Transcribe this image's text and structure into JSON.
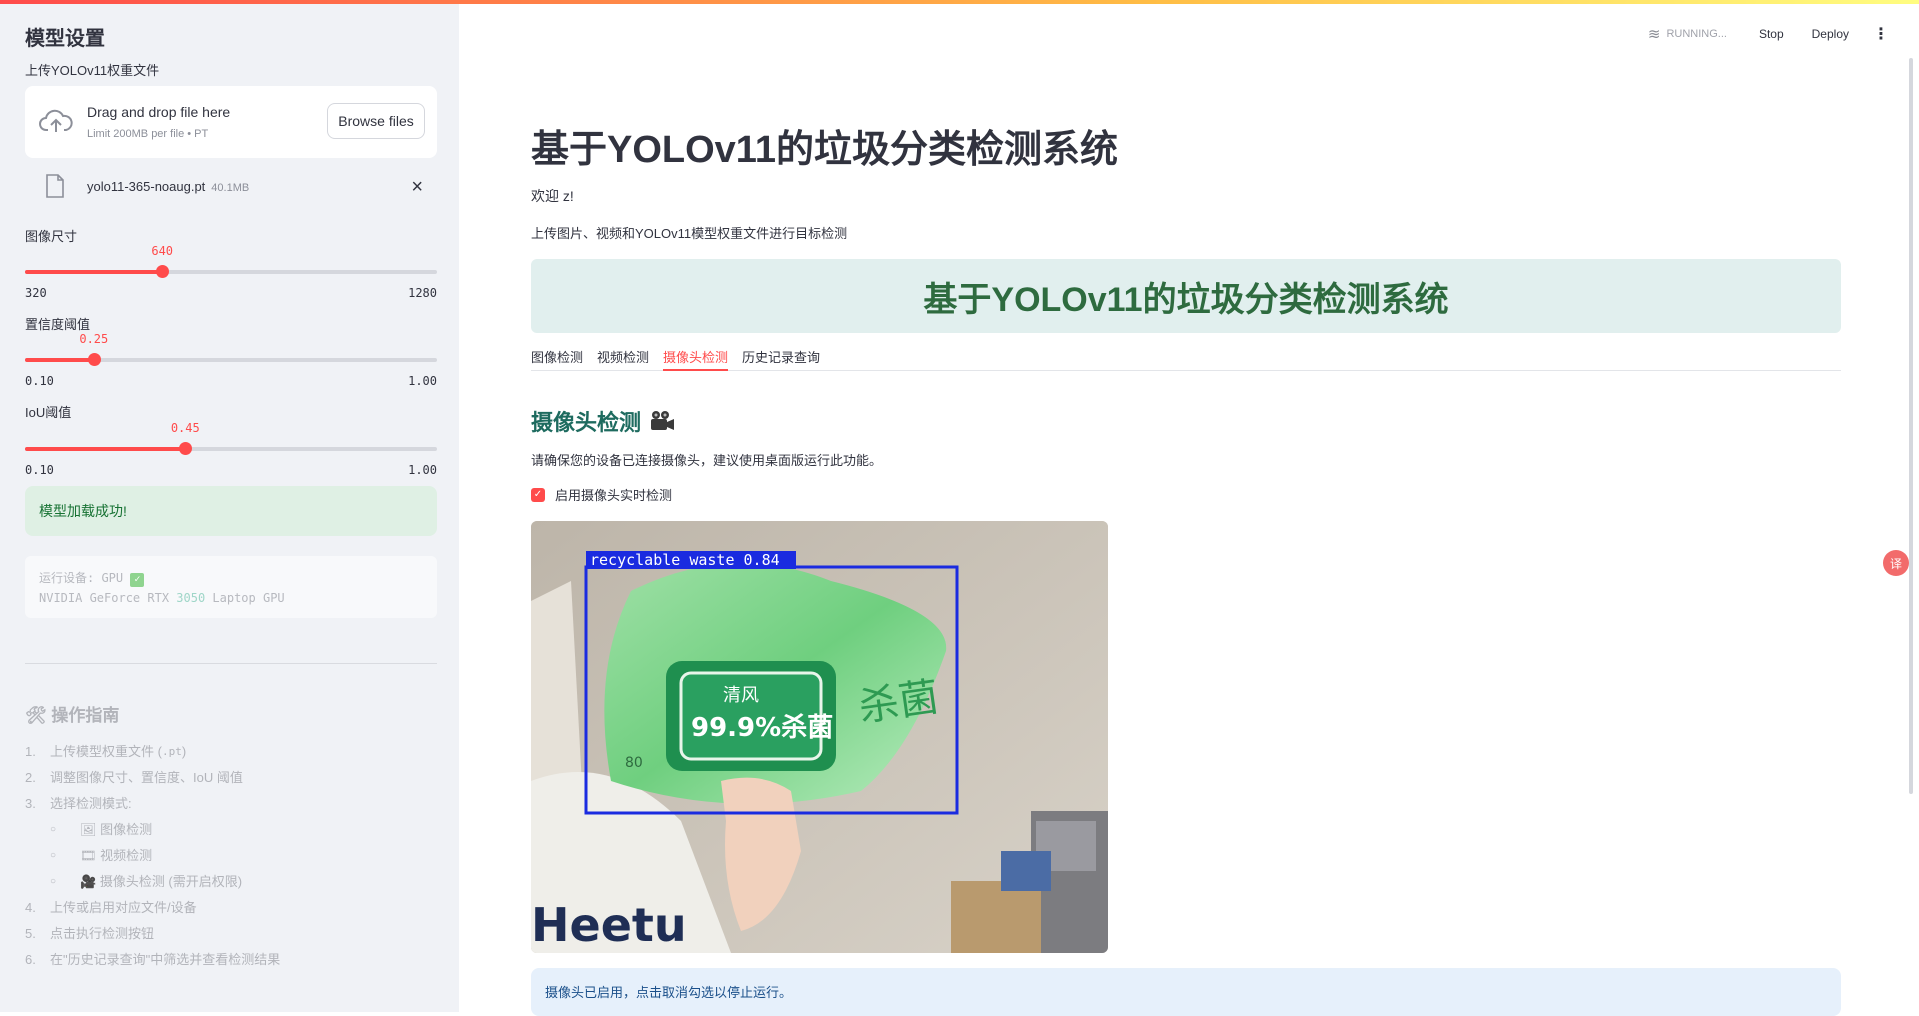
{
  "sidebar": {
    "title": "模型设置",
    "upload_label": "上传YOLOv11权重文件",
    "drop_main": "Drag and drop file here",
    "drop_sub": "Limit 200MB per file • PT",
    "browse_label": "Browse files",
    "file_name": "yolo11-365-noaug.pt",
    "file_size": "40.1MB",
    "close_icon": "×",
    "img_size": {
      "label": "图像尺寸",
      "value": "640",
      "min": "320",
      "max": "1280",
      "fraction": 0.333
    },
    "conf": {
      "label": "置信度阈值",
      "value": "0.25",
      "min": "0.10",
      "max": "1.00",
      "fraction": 0.167
    },
    "iou": {
      "label": "IoU阈值",
      "value": "0.45",
      "min": "0.10",
      "max": "1.00",
      "fraction": 0.389
    },
    "success_text": "模型加载成功!",
    "device_line1": "运行设备: GPU",
    "device_line2_a": "NVIDIA GeForce RTX ",
    "device_line2_b": "3050",
    "device_line2_c": " Laptop GPU",
    "guide_title": "操作指南",
    "guide": [
      {
        "num": "1.",
        "text_a": "上传模型权重文件 ( ",
        "code": ".pt",
        "text_b": " )"
      },
      {
        "num": "2.",
        "text": "调整图像尺寸、置信度、IoU 阈值"
      },
      {
        "num": "3.",
        "text": "选择检测模式:"
      },
      {
        "num": "4.",
        "text": "上传或启用对应文件/设备"
      },
      {
        "num": "5.",
        "text": "点击执行检测按钮"
      },
      {
        "num": "6.",
        "text": "在\"历史记录查询\"中筛选并查看检测结果"
      }
    ],
    "guide_sub": [
      {
        "icon": "🖼",
        "text": "图像检测"
      },
      {
        "icon": "🎞",
        "text": "视频检测"
      },
      {
        "icon": "🎥",
        "text": "摄像头检测 (需开启权限)"
      }
    ]
  },
  "header": {
    "running": "RUNNING...",
    "stop": "Stop",
    "deploy": "Deploy",
    "menu": "⋮"
  },
  "main": {
    "title": "基于YOLOv11的垃圾分类检测系统",
    "welcome": "欢迎 z!",
    "desc": "上传图片、视频和YOLOv11模型权重文件进行目标检测",
    "banner": "基于YOLOv11的垃圾分类检测系统",
    "tabs": [
      "图像检测",
      "视频检测",
      "摄像头检测",
      "历史记录查询"
    ],
    "active_tab": 2,
    "section_title": "摄像头检测",
    "notice": "请确保您的设备已连接摄像头，建议使用桌面版运行此功能。",
    "checkbox_label": "启用摄像头实时检测",
    "detection_label": "recyclable waste 0.84",
    "package_brand": "清风",
    "package_text": "99.9%杀菌",
    "package_side": "杀菌",
    "package_count": "80",
    "shirt_text": "Heetu",
    "info": "摄像头已启用，点击取消勾选以停止运行。"
  },
  "colors": {
    "accent": "#ff4b4b",
    "success_bg": "#dff0e4",
    "banner_bg": "#e1efee",
    "banner_text": "#2e6b3f",
    "box": "#1a2be0"
  }
}
